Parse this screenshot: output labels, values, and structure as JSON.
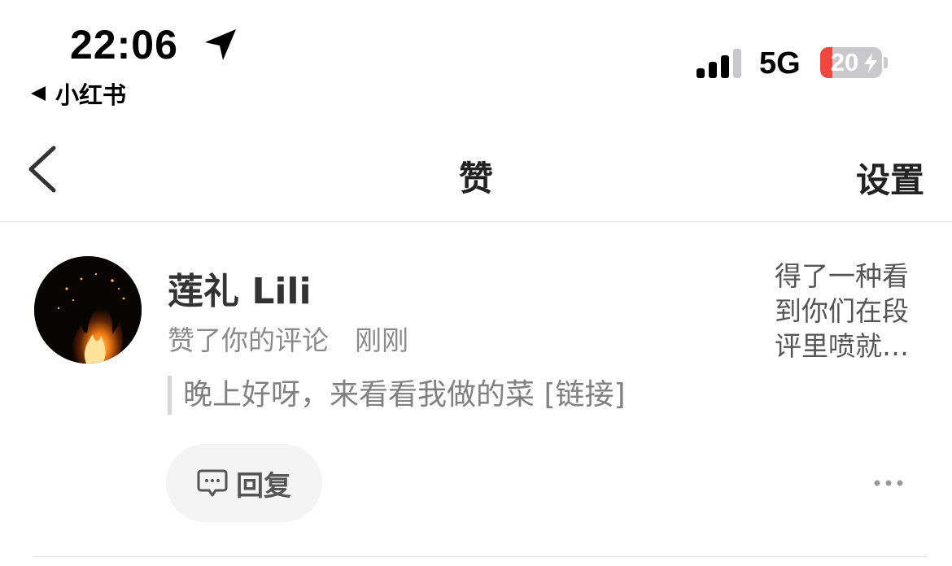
{
  "status_bar": {
    "time": "22:06",
    "back_app_label": "小红书",
    "network": "5G",
    "battery_percent": "20",
    "battery_level": 0.2
  },
  "nav": {
    "title": "赞",
    "settings_label": "设置"
  },
  "notification": {
    "username": "莲礼 Lili",
    "action": "赞了你的评论",
    "time": "刚刚",
    "quoted_comment": "晚上好呀，来看看我做的菜 [链接]",
    "note_preview": "得了一种看到你们在段评里喷就…",
    "reply_label": "回复"
  },
  "colors": {
    "battery_low": "#f0463b",
    "secondary_text": "#8a8a8a",
    "reply_bg": "#f4f4f4"
  }
}
